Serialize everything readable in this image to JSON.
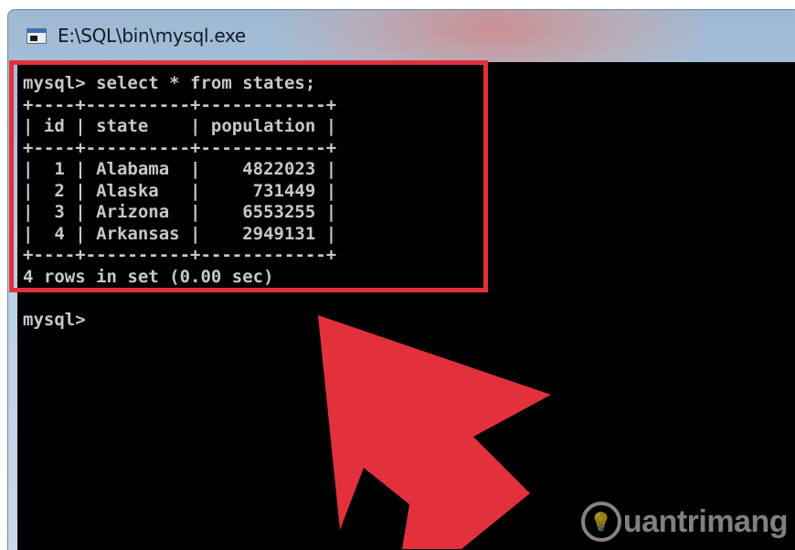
{
  "window": {
    "title": "E:\\SQL\\bin\\mysql.exe",
    "icon": "console-app-icon"
  },
  "console": {
    "lines": [
      "mysql> select * from states;",
      "+----+----------+------------+",
      "| id | state    | population |",
      "+----+----------+------------+",
      "|  1 | Alabama  |    4822023 |",
      "|  2 | Alaska   |     731449 |",
      "|  3 | Arizona  |    6553255 |",
      "|  4 | Arkansas |    2949131 |",
      "+----+----------+------------+",
      "4 rows in set (0.00 sec)",
      "",
      "mysql>"
    ],
    "text_color": "#c8c8c8",
    "background": "#000000"
  },
  "annotation": {
    "highlight_color": "#e2313c",
    "arrow_color": "#e2313c"
  },
  "watermark": {
    "text": "uantrimang",
    "icon": "lightbulb-q-icon"
  }
}
